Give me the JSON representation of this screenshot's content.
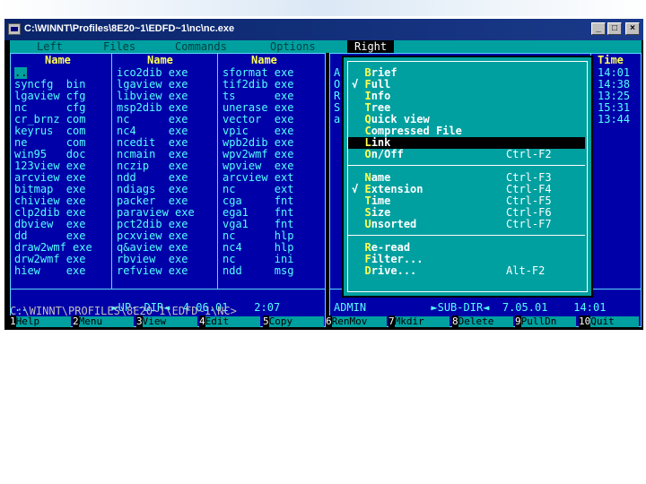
{
  "window": {
    "title": "C:\\WINNT\\Profiles\\8E20~1\\EDFD~1\\nc\\nc.exe",
    "btn_min": "_",
    "btn_max": "□",
    "btn_close": "×"
  },
  "menubar": [
    "Left",
    "Files",
    "Commands",
    "Options",
    "Right"
  ],
  "left_panel": {
    "headers": [
      "Name",
      "Name",
      "Name"
    ],
    "col1": [
      "..",
      "syncfg  bin",
      "lgaview cfg",
      "nc      cfg",
      "cr_brnz com",
      "keyrus  com",
      "ne      com",
      "win95   doc",
      "123view exe",
      "arcview exe",
      "bitmap  exe",
      "chiview exe",
      "clp2dib exe",
      "dbview  exe",
      "dd      exe",
      "draw2wmf exe",
      "drw2wmf exe",
      "hiew    exe"
    ],
    "col2": [
      "ico2dib exe",
      "lgaview exe",
      "libview exe",
      "msp2dib exe",
      "nc      exe",
      "nc4     exe",
      "ncedit  exe",
      "ncmain  exe",
      "nczip   exe",
      "ndd     exe",
      "ndiags  exe",
      "packer  exe",
      "paraview exe",
      "pct2dib exe",
      "pcxview exe",
      "q&aview exe",
      "rbview  exe",
      "refview exe"
    ],
    "col3": [
      "sformat exe",
      "tif2dib exe",
      "ts      exe",
      "unerase exe",
      "vector  exe",
      "vpic    exe",
      "wpb2dib exe",
      "wpv2wmf exe",
      "wpview  exe",
      "arcview ext",
      "nc      ext",
      "cga     fnt",
      "ega1    fnt",
      "vga1    fnt",
      "nc      hlp",
      "nc4     hlp",
      "nc      ini",
      "ndd     msg"
    ],
    "status": "..             ►UP--DIR◄  4.06.01    2:07"
  },
  "right_panel": {
    "letters": [
      "A",
      "O",
      "R",
      "S",
      "a"
    ],
    "time_header": "Time",
    "times": [
      "14:01",
      "14:38",
      "13:25",
      "15:31",
      "13:44"
    ],
    "status": "ADMIN          ►SUB-DIR◄  7.05.01    14:01"
  },
  "dropdown": {
    "items": [
      {
        "check": " ",
        "key": "B",
        "rest": "rief",
        "shortcut": ""
      },
      {
        "check": "√",
        "key": "F",
        "rest": "ull",
        "shortcut": ""
      },
      {
        "check": " ",
        "key": "I",
        "rest": "nfo",
        "shortcut": ""
      },
      {
        "check": " ",
        "key": "T",
        "rest": "ree",
        "shortcut": ""
      },
      {
        "check": " ",
        "key": "Q",
        "rest": "uick view",
        "shortcut": ""
      },
      {
        "check": " ",
        "key": "C",
        "rest": "ompressed File",
        "shortcut": ""
      },
      {
        "check": " ",
        "key": "L",
        "rest": "ink",
        "shortcut": ""
      },
      {
        "check": " ",
        "key": "O",
        "rest": "n/Off",
        "shortcut": "Ctrl-F2"
      },
      {
        "check": " ",
        "key": "N",
        "rest": "ame",
        "shortcut": "Ctrl-F3"
      },
      {
        "check": "√",
        "key": "E",
        "rest": "xtension",
        "shortcut": "Ctrl-F4"
      },
      {
        "check": " ",
        "key": "T",
        "rest": "ime",
        "shortcut": "Ctrl-F5"
      },
      {
        "check": " ",
        "key": "S",
        "rest": "ize",
        "shortcut": "Ctrl-F6"
      },
      {
        "check": " ",
        "key": "U",
        "rest": "nsorted",
        "shortcut": "Ctrl-F7"
      },
      {
        "check": " ",
        "key": "R",
        "rest": "e-read",
        "shortcut": ""
      },
      {
        "check": " ",
        "key": "F",
        "rest": "ilter...",
        "shortcut": ""
      },
      {
        "check": " ",
        "key": "D",
        "rest": "rive...",
        "shortcut": "Alt-F2"
      }
    ]
  },
  "cmdline": "C:\\WINNT\\PROFILES\\8E20~1\\EDFD~1\\NC>",
  "fkeys": [
    {
      "n": "1",
      "l": "Help"
    },
    {
      "n": "2",
      "l": "Menu"
    },
    {
      "n": "3",
      "l": "View"
    },
    {
      "n": "4",
      "l": "Edit"
    },
    {
      "n": "5",
      "l": "Copy"
    },
    {
      "n": "6",
      "l": "RenMov"
    },
    {
      "n": "7",
      "l": "Mkdir"
    },
    {
      "n": "8",
      "l": "Delete"
    },
    {
      "n": "9",
      "l": "PullDn"
    },
    {
      "n": "10",
      "l": "Quit"
    }
  ]
}
